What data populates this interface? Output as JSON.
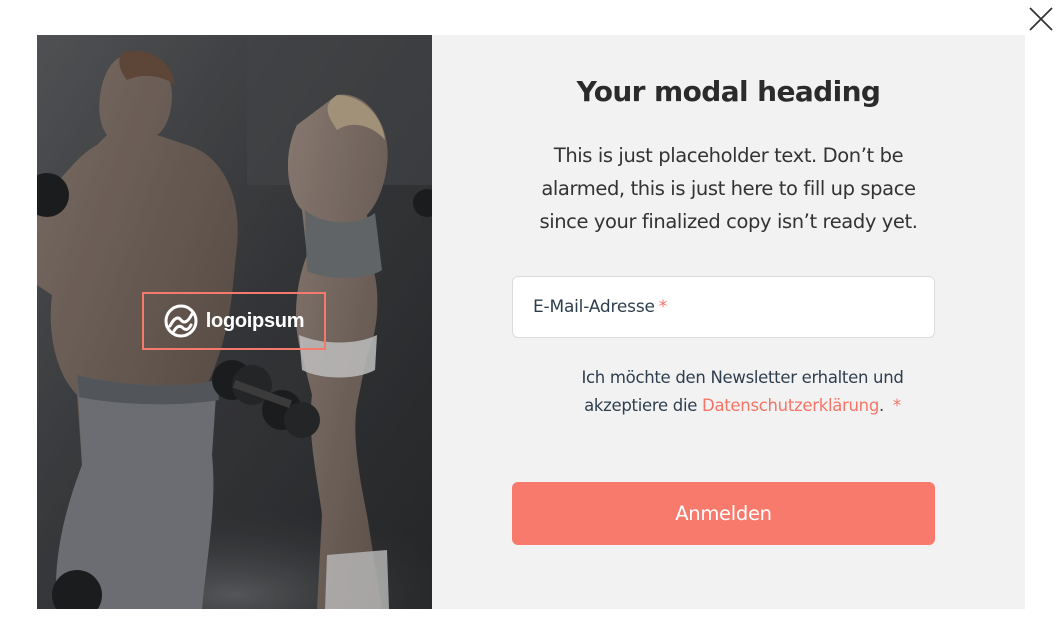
{
  "close": {
    "icon": "close-icon"
  },
  "image_panel": {
    "description_icon": "fitness-photo",
    "logo": {
      "icon": "logoipsum-mark-icon",
      "text": "logoipsum"
    }
  },
  "modal": {
    "heading": "Your modal heading",
    "body": "This is just placeholder text. Don’t be alarmed, this is just here to fill up space since your finalized copy isn’t ready yet.",
    "email": {
      "label": "E-Mail-Adresse",
      "required_marker": "*"
    },
    "consent": {
      "text_before": "Ich möchte den Newsletter erhalten und akzeptiere die ",
      "link_text": "Datenschutzerklärung",
      "text_after": ".",
      "required_marker": "*"
    },
    "submit_label": "Anmelden"
  },
  "colors": {
    "accent": "#f87a6d",
    "link": "#f47567",
    "panel_background": "#f2f2f2",
    "heading": "#2b2b2b"
  }
}
